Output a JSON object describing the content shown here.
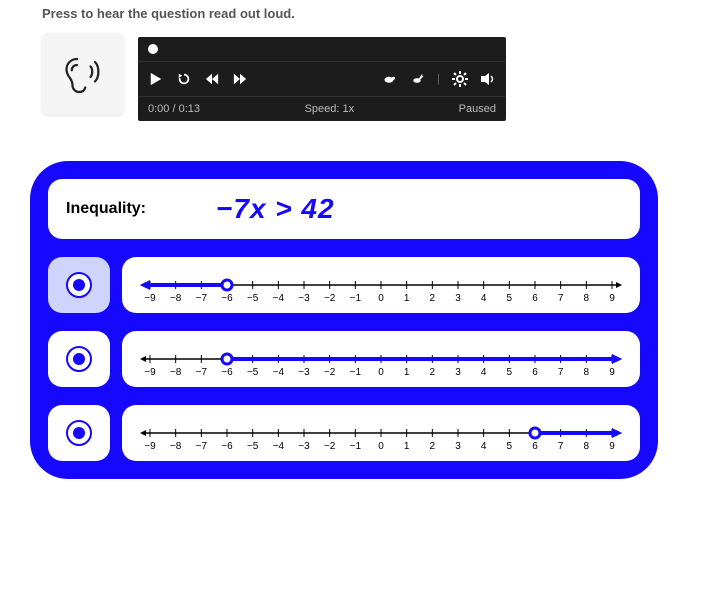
{
  "instruction": "Press to hear the question read out loud.",
  "player": {
    "time": "0:00 / 0:13",
    "speed": "Speed: 1x",
    "status": "Paused"
  },
  "inequality": {
    "label": "Inequality:",
    "expression": "−7x > 42"
  },
  "numberline": {
    "min": -9,
    "max": 9,
    "labels": [
      "−9",
      "−8",
      "−7",
      "−6",
      "−5",
      "−4",
      "−3",
      "−2",
      "−1",
      "0",
      "1",
      "2",
      "3",
      "4",
      "5",
      "6",
      "7",
      "8",
      "9"
    ]
  },
  "options": [
    {
      "selected": true,
      "point": -6,
      "open": true,
      "direction": "left"
    },
    {
      "selected": false,
      "point": -6,
      "open": true,
      "direction": "right"
    },
    {
      "selected": false,
      "point": 6,
      "open": true,
      "direction": "right"
    }
  ]
}
